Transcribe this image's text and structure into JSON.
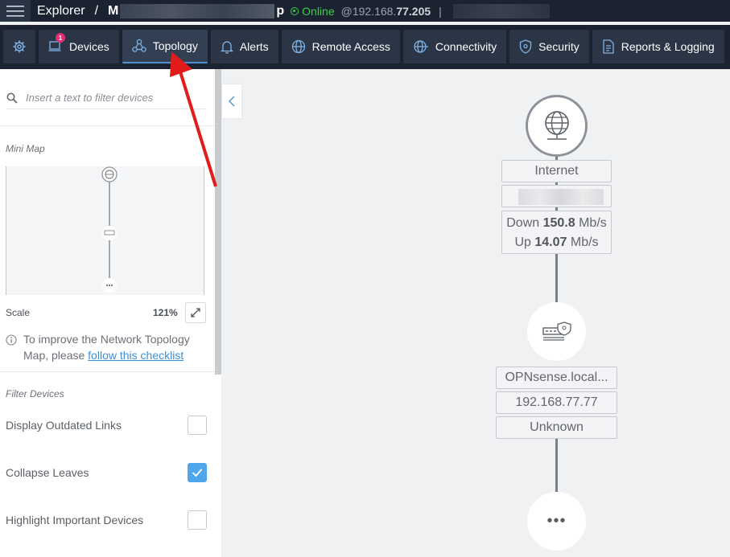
{
  "topbar": {
    "app": "Explorer",
    "separator": "/",
    "network_prefix": "M",
    "network_suffix": "p",
    "status": "Online",
    "ip_prefix": "@192.168.",
    "ip_highlight": "77.205",
    "bar_separator": "|"
  },
  "nav": {
    "devices_badge": "1",
    "items": [
      {
        "label": "Devices"
      },
      {
        "label": "Topology"
      },
      {
        "label": "Alerts"
      },
      {
        "label": "Remote Access"
      },
      {
        "label": "Connectivity"
      },
      {
        "label": "Security"
      },
      {
        "label": "Reports & Logging"
      }
    ],
    "active": "Topology"
  },
  "sidebar": {
    "search_placeholder": "Insert a text to filter devices",
    "minimap_title": "Mini Map",
    "scale_label": "Scale",
    "scale_value": "121%",
    "tip_text": "To improve the Network Topology Map, please ",
    "tip_link": "follow this checklist",
    "filter_title": "Filter Devices",
    "filters": [
      {
        "label": "Display Outdated Links",
        "checked": false
      },
      {
        "label": "Collapse Leaves",
        "checked": true
      },
      {
        "label": "Highlight Important Devices",
        "checked": false
      }
    ]
  },
  "topology": {
    "internet": {
      "label": "Internet",
      "down_label": "Down",
      "down_value": "150.8",
      "up_label": "Up",
      "up_value": "14.07",
      "unit": "Mb/s"
    },
    "gateway": {
      "name": "OPNsense.local...",
      "ip": "192.168.77.77",
      "type": "Unknown"
    },
    "more_glyph": "•••"
  },
  "colors": {
    "topbar_bg": "#1b2330",
    "nav_item_bg": "#2b3545",
    "accent": "#4c93d6",
    "online": "#3ccf4a",
    "badge": "#e0306e",
    "checkbox_checked": "#4ea6ec",
    "annotation_arrow": "#e21b1b"
  }
}
